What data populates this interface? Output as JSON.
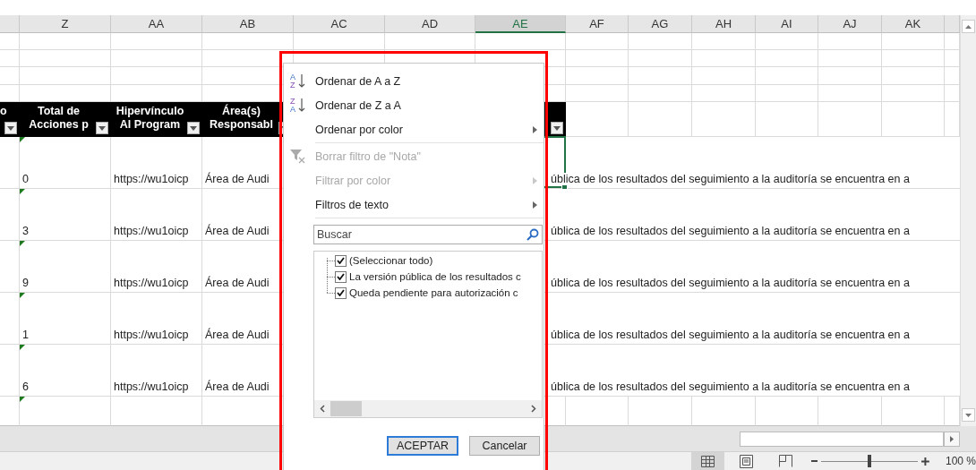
{
  "column_headers": [
    {
      "label": "Z",
      "selected": false
    },
    {
      "label": "AA",
      "selected": false
    },
    {
      "label": "AB",
      "selected": false
    },
    {
      "label": "AC",
      "selected": false
    },
    {
      "label": "AD",
      "selected": false
    },
    {
      "label": "AE",
      "selected": true
    },
    {
      "label": "AF",
      "selected": false
    },
    {
      "label": "AG",
      "selected": false
    },
    {
      "label": "AH",
      "selected": false
    },
    {
      "label": "AI",
      "selected": false
    },
    {
      "label": "AJ",
      "selected": false
    },
    {
      "label": "AK",
      "selected": false
    }
  ],
  "table": {
    "headers": [
      {
        "lines": [
          "o"
        ]
      },
      {
        "lines": [
          "Total de",
          "Acciones p"
        ]
      },
      {
        "lines": [
          "Hipervínculo",
          "Al Program"
        ]
      },
      {
        "lines": [
          "Área(s)",
          "Responsabl"
        ]
      }
    ],
    "rows": [
      {
        "cells": [
          "0",
          "https://wu1oicp",
          "Área de Audi"
        ],
        "overflow_text": "ública de los resultados del seguimiento a la auditoría se encuentra en a",
        "selected": true
      },
      {
        "cells": [
          "3",
          "https://wu1oicp",
          "Área de Audi"
        ],
        "overflow_text": "ública de los resultados del seguimiento a la auditoría se encuentra en a",
        "selected": false
      },
      {
        "cells": [
          "9",
          "https://wu1oicp",
          "Área de Audi"
        ],
        "overflow_text": "ública de los resultados del seguimiento a la auditoría se encuentra en a",
        "selected": false
      },
      {
        "cells": [
          "1",
          "https://wu1oicp",
          "Área de Audi"
        ],
        "overflow_text": "ública de los resultados del seguimiento a la auditoría se encuentra en a",
        "selected": false
      },
      {
        "cells": [
          "6",
          "https://wu1oicp",
          "Área de Audi"
        ],
        "overflow_text": "ública de los resultados del seguimiento a la auditoría se encuentra en a",
        "selected": false
      }
    ]
  },
  "filter_menu": {
    "items": [
      {
        "kind": "sort_ascending",
        "label": "Ordenar de A a Z",
        "icon_letters": [
          "A",
          "Z"
        ],
        "disabled": false,
        "submenu": false
      },
      {
        "kind": "sort_descending",
        "label": "Ordenar de Z a A",
        "icon_letters": [
          "Z",
          "A"
        ],
        "disabled": false,
        "submenu": false
      },
      {
        "kind": "command",
        "label": "Ordenar por color",
        "disabled": false,
        "submenu": true
      },
      {
        "kind": "separator"
      },
      {
        "kind": "clear_filter",
        "label": "Borrar filtro de \"Nota\"",
        "disabled": true,
        "submenu": false
      },
      {
        "kind": "command",
        "label": "Filtrar por color",
        "disabled": true,
        "submenu": true
      },
      {
        "kind": "command",
        "label": "Filtros de texto",
        "disabled": false,
        "submenu": true
      },
      {
        "kind": "separator"
      }
    ],
    "search": {
      "placeholder": "Buscar"
    },
    "values": [
      {
        "label": "(Seleccionar todo)",
        "checked": true
      },
      {
        "label": "La versión pública de los resultados c",
        "checked": true
      },
      {
        "label": "Queda pendiente para autorización c",
        "checked": true
      }
    ],
    "buttons": [
      {
        "kind": "primary",
        "label": "ACEPTAR"
      },
      {
        "kind": "secondary",
        "label": "Cancelar"
      }
    ]
  },
  "annotation": {
    "kind": "frame"
  },
  "status_bar": {
    "views": [
      {
        "kind": "normal",
        "selected": true
      },
      {
        "kind": "page_layout",
        "selected": false
      },
      {
        "kind": "page_break",
        "selected": false
      }
    ],
    "zoom": {
      "level": 0.5,
      "label": "100 %"
    }
  }
}
